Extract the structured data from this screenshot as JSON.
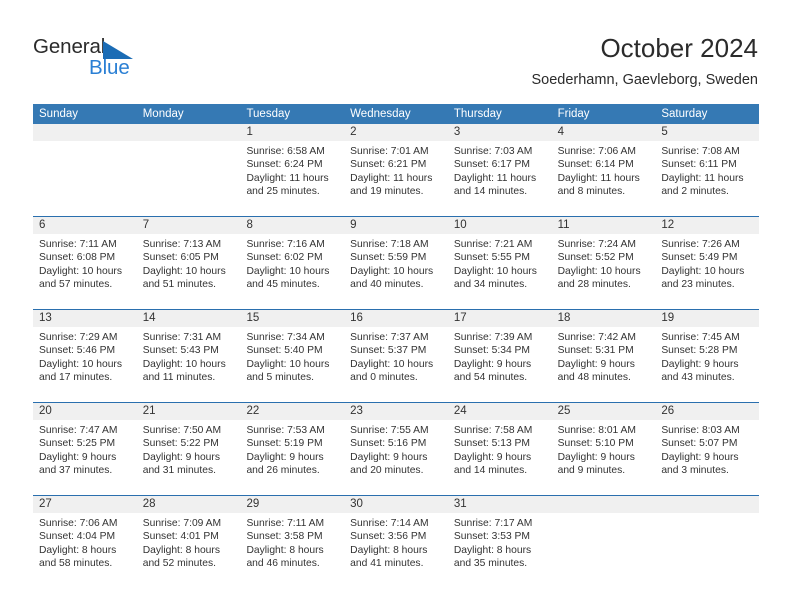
{
  "brand": {
    "name_part1": "General",
    "name_part2": "Blue",
    "triangle_color": "#1b6cb5",
    "blue_text_color": "#2a7fd4"
  },
  "header": {
    "title": "October 2024",
    "subtitle": "Soederhamn, Gaevleborg, Sweden"
  },
  "theme": {
    "header_blue": "#3579b4",
    "row_divider_blue": "#2a6fae",
    "day_band_gray": "#f0f0f0",
    "text_color": "#333333"
  },
  "weekdays": [
    "Sunday",
    "Monday",
    "Tuesday",
    "Wednesday",
    "Thursday",
    "Friday",
    "Saturday"
  ],
  "weeks": [
    {
      "days": [
        {
          "num": "",
          "sunrise": "",
          "sunset": "",
          "daylight_line1": "",
          "daylight_line2": ""
        },
        {
          "num": "",
          "sunrise": "",
          "sunset": "",
          "daylight_line1": "",
          "daylight_line2": ""
        },
        {
          "num": "1",
          "sunrise": "Sunrise: 6:58 AM",
          "sunset": "Sunset: 6:24 PM",
          "daylight_line1": "Daylight: 11 hours",
          "daylight_line2": "and 25 minutes."
        },
        {
          "num": "2",
          "sunrise": "Sunrise: 7:01 AM",
          "sunset": "Sunset: 6:21 PM",
          "daylight_line1": "Daylight: 11 hours",
          "daylight_line2": "and 19 minutes."
        },
        {
          "num": "3",
          "sunrise": "Sunrise: 7:03 AM",
          "sunset": "Sunset: 6:17 PM",
          "daylight_line1": "Daylight: 11 hours",
          "daylight_line2": "and 14 minutes."
        },
        {
          "num": "4",
          "sunrise": "Sunrise: 7:06 AM",
          "sunset": "Sunset: 6:14 PM",
          "daylight_line1": "Daylight: 11 hours",
          "daylight_line2": "and 8 minutes."
        },
        {
          "num": "5",
          "sunrise": "Sunrise: 7:08 AM",
          "sunset": "Sunset: 6:11 PM",
          "daylight_line1": "Daylight: 11 hours",
          "daylight_line2": "and 2 minutes."
        }
      ]
    },
    {
      "days": [
        {
          "num": "6",
          "sunrise": "Sunrise: 7:11 AM",
          "sunset": "Sunset: 6:08 PM",
          "daylight_line1": "Daylight: 10 hours",
          "daylight_line2": "and 57 minutes."
        },
        {
          "num": "7",
          "sunrise": "Sunrise: 7:13 AM",
          "sunset": "Sunset: 6:05 PM",
          "daylight_line1": "Daylight: 10 hours",
          "daylight_line2": "and 51 minutes."
        },
        {
          "num": "8",
          "sunrise": "Sunrise: 7:16 AM",
          "sunset": "Sunset: 6:02 PM",
          "daylight_line1": "Daylight: 10 hours",
          "daylight_line2": "and 45 minutes."
        },
        {
          "num": "9",
          "sunrise": "Sunrise: 7:18 AM",
          "sunset": "Sunset: 5:59 PM",
          "daylight_line1": "Daylight: 10 hours",
          "daylight_line2": "and 40 minutes."
        },
        {
          "num": "10",
          "sunrise": "Sunrise: 7:21 AM",
          "sunset": "Sunset: 5:55 PM",
          "daylight_line1": "Daylight: 10 hours",
          "daylight_line2": "and 34 minutes."
        },
        {
          "num": "11",
          "sunrise": "Sunrise: 7:24 AM",
          "sunset": "Sunset: 5:52 PM",
          "daylight_line1": "Daylight: 10 hours",
          "daylight_line2": "and 28 minutes."
        },
        {
          "num": "12",
          "sunrise": "Sunrise: 7:26 AM",
          "sunset": "Sunset: 5:49 PM",
          "daylight_line1": "Daylight: 10 hours",
          "daylight_line2": "and 23 minutes."
        }
      ]
    },
    {
      "days": [
        {
          "num": "13",
          "sunrise": "Sunrise: 7:29 AM",
          "sunset": "Sunset: 5:46 PM",
          "daylight_line1": "Daylight: 10 hours",
          "daylight_line2": "and 17 minutes."
        },
        {
          "num": "14",
          "sunrise": "Sunrise: 7:31 AM",
          "sunset": "Sunset: 5:43 PM",
          "daylight_line1": "Daylight: 10 hours",
          "daylight_line2": "and 11 minutes."
        },
        {
          "num": "15",
          "sunrise": "Sunrise: 7:34 AM",
          "sunset": "Sunset: 5:40 PM",
          "daylight_line1": "Daylight: 10 hours",
          "daylight_line2": "and 5 minutes."
        },
        {
          "num": "16",
          "sunrise": "Sunrise: 7:37 AM",
          "sunset": "Sunset: 5:37 PM",
          "daylight_line1": "Daylight: 10 hours",
          "daylight_line2": "and 0 minutes."
        },
        {
          "num": "17",
          "sunrise": "Sunrise: 7:39 AM",
          "sunset": "Sunset: 5:34 PM",
          "daylight_line1": "Daylight: 9 hours",
          "daylight_line2": "and 54 minutes."
        },
        {
          "num": "18",
          "sunrise": "Sunrise: 7:42 AM",
          "sunset": "Sunset: 5:31 PM",
          "daylight_line1": "Daylight: 9 hours",
          "daylight_line2": "and 48 minutes."
        },
        {
          "num": "19",
          "sunrise": "Sunrise: 7:45 AM",
          "sunset": "Sunset: 5:28 PM",
          "daylight_line1": "Daylight: 9 hours",
          "daylight_line2": "and 43 minutes."
        }
      ]
    },
    {
      "days": [
        {
          "num": "20",
          "sunrise": "Sunrise: 7:47 AM",
          "sunset": "Sunset: 5:25 PM",
          "daylight_line1": "Daylight: 9 hours",
          "daylight_line2": "and 37 minutes."
        },
        {
          "num": "21",
          "sunrise": "Sunrise: 7:50 AM",
          "sunset": "Sunset: 5:22 PM",
          "daylight_line1": "Daylight: 9 hours",
          "daylight_line2": "and 31 minutes."
        },
        {
          "num": "22",
          "sunrise": "Sunrise: 7:53 AM",
          "sunset": "Sunset: 5:19 PM",
          "daylight_line1": "Daylight: 9 hours",
          "daylight_line2": "and 26 minutes."
        },
        {
          "num": "23",
          "sunrise": "Sunrise: 7:55 AM",
          "sunset": "Sunset: 5:16 PM",
          "daylight_line1": "Daylight: 9 hours",
          "daylight_line2": "and 20 minutes."
        },
        {
          "num": "24",
          "sunrise": "Sunrise: 7:58 AM",
          "sunset": "Sunset: 5:13 PM",
          "daylight_line1": "Daylight: 9 hours",
          "daylight_line2": "and 14 minutes."
        },
        {
          "num": "25",
          "sunrise": "Sunrise: 8:01 AM",
          "sunset": "Sunset: 5:10 PM",
          "daylight_line1": "Daylight: 9 hours",
          "daylight_line2": "and 9 minutes."
        },
        {
          "num": "26",
          "sunrise": "Sunrise: 8:03 AM",
          "sunset": "Sunset: 5:07 PM",
          "daylight_line1": "Daylight: 9 hours",
          "daylight_line2": "and 3 minutes."
        }
      ]
    },
    {
      "days": [
        {
          "num": "27",
          "sunrise": "Sunrise: 7:06 AM",
          "sunset": "Sunset: 4:04 PM",
          "daylight_line1": "Daylight: 8 hours",
          "daylight_line2": "and 58 minutes."
        },
        {
          "num": "28",
          "sunrise": "Sunrise: 7:09 AM",
          "sunset": "Sunset: 4:01 PM",
          "daylight_line1": "Daylight: 8 hours",
          "daylight_line2": "and 52 minutes."
        },
        {
          "num": "29",
          "sunrise": "Sunrise: 7:11 AM",
          "sunset": "Sunset: 3:58 PM",
          "daylight_line1": "Daylight: 8 hours",
          "daylight_line2": "and 46 minutes."
        },
        {
          "num": "30",
          "sunrise": "Sunrise: 7:14 AM",
          "sunset": "Sunset: 3:56 PM",
          "daylight_line1": "Daylight: 8 hours",
          "daylight_line2": "and 41 minutes."
        },
        {
          "num": "31",
          "sunrise": "Sunrise: 7:17 AM",
          "sunset": "Sunset: 3:53 PM",
          "daylight_line1": "Daylight: 8 hours",
          "daylight_line2": "and 35 minutes."
        },
        {
          "num": "",
          "sunrise": "",
          "sunset": "",
          "daylight_line1": "",
          "daylight_line2": ""
        },
        {
          "num": "",
          "sunrise": "",
          "sunset": "",
          "daylight_line1": "",
          "daylight_line2": ""
        }
      ]
    }
  ]
}
